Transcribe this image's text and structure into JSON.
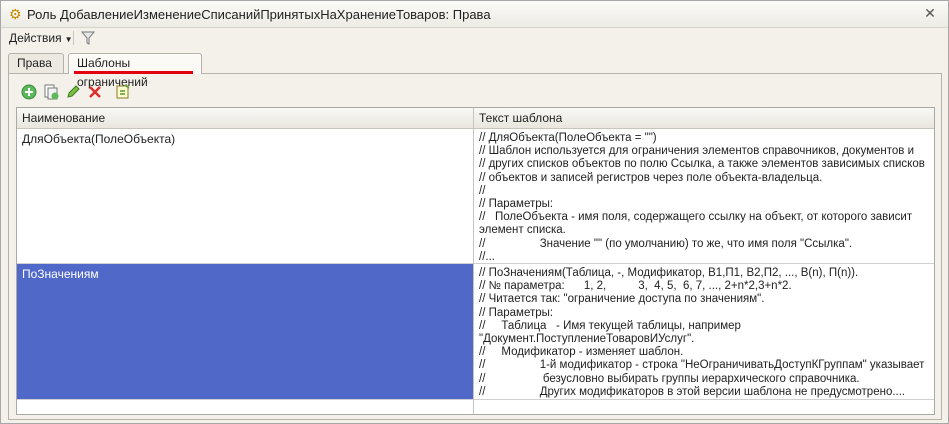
{
  "window": {
    "title": "Роль ДобавлениеИзменениеСписанийПринятыхНаХранениеТоваров: Права"
  },
  "toolbar": {
    "actions_label": "Действия"
  },
  "tabs": [
    {
      "label": "Права",
      "active": false
    },
    {
      "label": "Шаблоны ограничений",
      "active": true
    }
  ],
  "panel_icons": [
    "add-icon",
    "copy-icon",
    "edit-icon",
    "delete-icon",
    "export-icon"
  ],
  "accent": {
    "selection": "#5069c8",
    "underline": "#e3000f"
  },
  "table": {
    "columns": [
      "Наименование",
      "Текст шаблона"
    ],
    "rows": [
      {
        "name": "ДляОбъекта(ПолеОбъекта)",
        "text": "// ДляОбъекта(ПолеОбъекта = \"\")\n// Шаблон используется для ограничения элементов справочников, документов и\n// других списков объектов по полю Ссылка, а также элементов зависимых списков\n// объектов и записей регистров через поле объекта-владельца.\n//\n// Параметры:\n//   ПолеОбъекта - имя поля, содержащего ссылку на объект, от которого зависит\nэлемент списка.\n//                 Значение \"\" (по умолчанию) то же, что имя поля \"Ссылка\".\n//...",
        "selected": false
      },
      {
        "name": "ПоЗначениям",
        "text": "// ПоЗначениям(Таблица, -, Модификатор, В1,П1, В2,П2, ..., В(n), П(n)).\n// № параметра:      1, 2,          3,  4, 5,  6, 7, ..., 2+n*2,3+n*2.\n// Читается так: \"ограничение доступа по значениям\".\n// Параметры:\n//     Таблица   - Имя текущей таблицы, например\n\"Документ.ПоступлениеТоваровИУслуг\".\n//     Модификатор - изменяет шаблон.\n//                 1-й модификатор - строка \"НеОграничиватьДоступКГруппам\" указывает\n//                  безусловно выбирать группы иерархического справочника.\n//                 Других модификаторов в этой версии шаблона не предусмотрено....",
        "selected": true
      }
    ]
  }
}
